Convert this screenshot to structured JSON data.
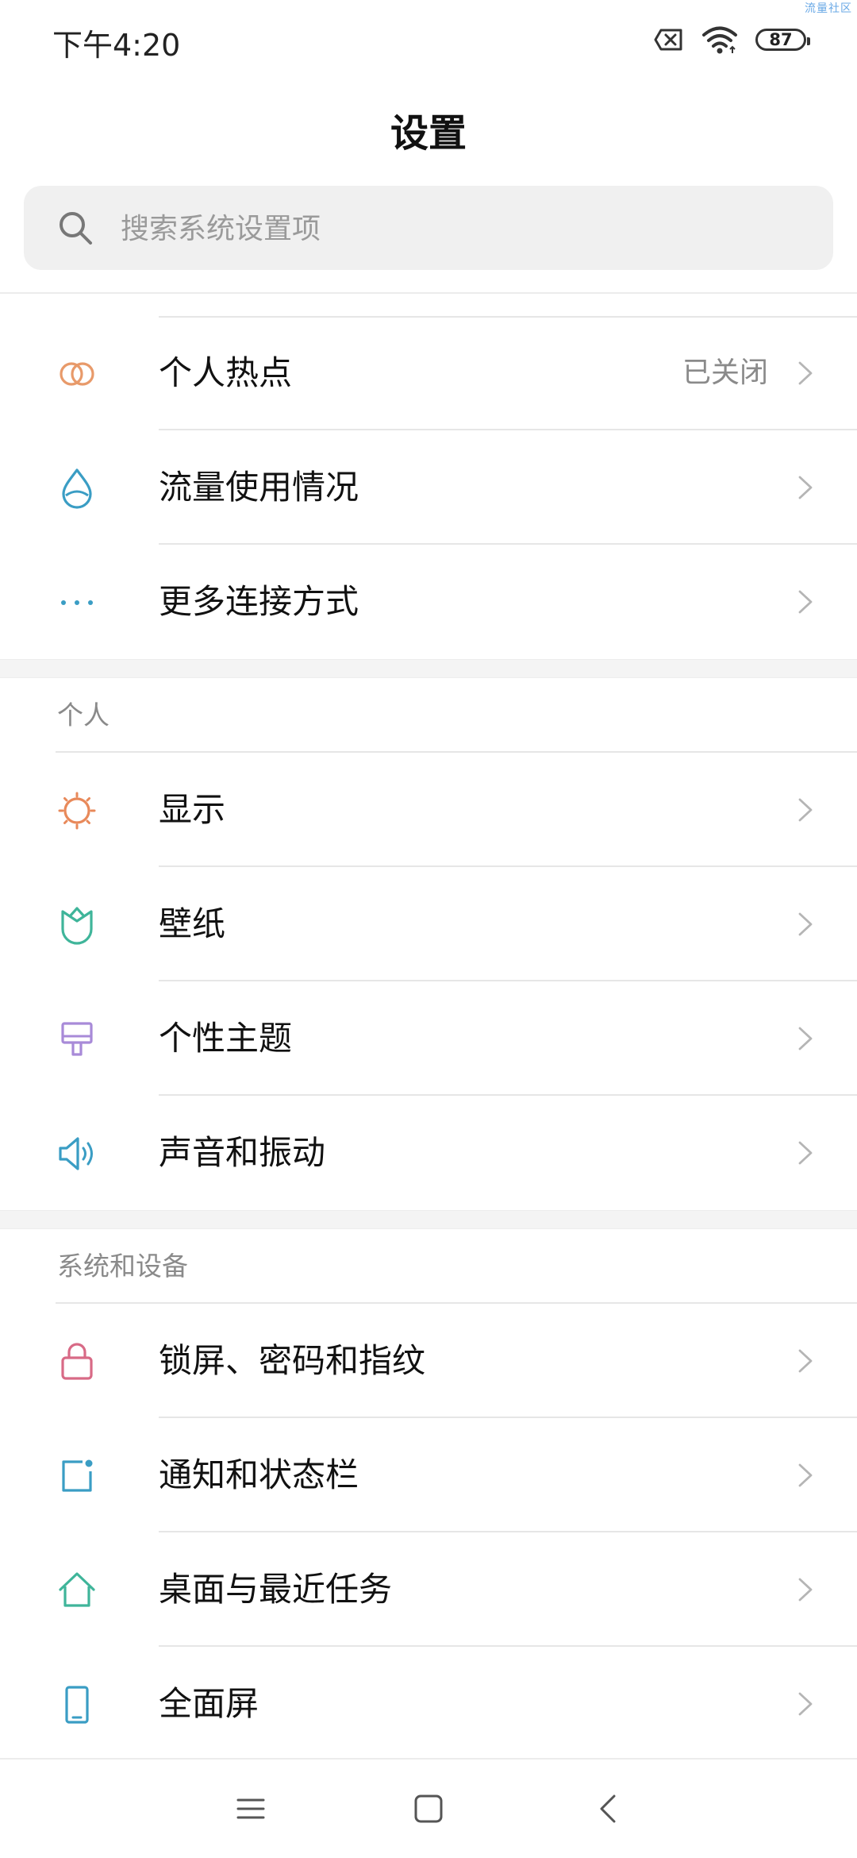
{
  "watermark": "流量社区",
  "status_bar": {
    "time": "下午4:20",
    "battery": "87",
    "icons": [
      "sim-x-icon",
      "wifi-icon",
      "battery-icon"
    ]
  },
  "title": "设置",
  "search": {
    "placeholder": "搜索系统设置项",
    "icon": "search-icon"
  },
  "connect_items": [
    {
      "label": "个人热点",
      "value": "已关闭",
      "icon": "hotspot-icon",
      "color": "#e89a6a"
    },
    {
      "label": "流量使用情况",
      "value": "",
      "icon": "data-usage-icon",
      "color": "#3a9dc4"
    },
    {
      "label": "更多连接方式",
      "value": "",
      "icon": "more-connections-icon",
      "color": "#3a9dc4"
    }
  ],
  "personal_section": {
    "header": "个人",
    "items": [
      {
        "label": "显示",
        "icon": "display-icon",
        "color": "#e8895a"
      },
      {
        "label": "壁纸",
        "icon": "wallpaper-icon",
        "color": "#3fb59a"
      },
      {
        "label": "个性主题",
        "icon": "theme-icon",
        "color": "#a88ad8"
      },
      {
        "label": "声音和振动",
        "icon": "sound-icon",
        "color": "#3a9dc4"
      }
    ]
  },
  "system_section": {
    "header": "系统和设备",
    "items": [
      {
        "label": "锁屏、密码和指纹",
        "icon": "lock-icon",
        "color": "#d86a86"
      },
      {
        "label": "通知和状态栏",
        "icon": "notification-icon",
        "color": "#3a9dc4"
      },
      {
        "label": "桌面与最近任务",
        "icon": "home-icon",
        "color": "#3fb59a"
      },
      {
        "label": "全面屏",
        "icon": "fullscreen-icon",
        "color": "#3a9dc4"
      }
    ]
  },
  "nav_bar": {
    "buttons": [
      "menu-icon",
      "home-button-icon",
      "back-icon"
    ]
  }
}
